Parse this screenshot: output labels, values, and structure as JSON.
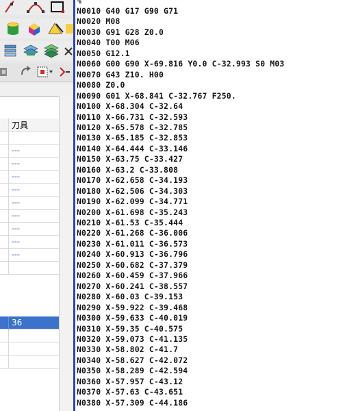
{
  "toolbar": {
    "icons": [
      "curve-tool-icon",
      "arc-tool-icon",
      "rect-tool-icon",
      "cylinder-icon",
      "box-icon",
      "stock-icon",
      "ruler-icon",
      "layers-a-icon",
      "layers-b-icon",
      "layers-c-icon",
      "misc-icon",
      "refresh-icon",
      "select-icon",
      "step-icon"
    ]
  },
  "table": {
    "header": "刀具",
    "rows": [
      "",
      "---",
      "---",
      "---",
      "---",
      "---",
      "---",
      "---",
      "---",
      "---",
      "",
      "36",
      "",
      "",
      ""
    ]
  },
  "code": {
    "first_line": "%",
    "lines": [
      "N0010 G40 G17 G90 G71",
      "N0020 M08",
      "N0030 G91 G28 Z0.0",
      "N0040 T00 M06",
      "N0050 G12.1",
      "N0060 G00 G90 X-69.816 Y0.0 C-32.993 S0 M03",
      "N0070 G43 Z10. H00",
      "N0080 Z0.0",
      "N0090 G01 X-68.841 C-32.767 F250.",
      "N0100 X-68.304 C-32.64",
      "N0110 X-66.731 C-32.593",
      "N0120 X-65.578 C-32.785",
      "N0130 X-65.185 C-32.853",
      "N0140 X-64.444 C-33.146",
      "N0150 X-63.75 C-33.427",
      "N0160 X-63.2 C-33.808",
      "N0170 X-62.658 C-34.193",
      "N0180 X-62.506 C-34.303",
      "N0190 X-62.099 C-34.771",
      "N0200 X-61.698 C-35.243",
      "N0210 X-61.53 C-35.444",
      "N0220 X-61.268 C-36.006",
      "N0230 X-61.011 C-36.573",
      "N0240 X-60.913 C-36.796",
      "N0250 X-60.682 C-37.379",
      "N0260 X-60.459 C-37.966",
      "N0270 X-60.241 C-38.557",
      "N0280 X-60.03 C-39.153",
      "N0290 X-59.922 C-39.468",
      "N0300 X-59.633 C-40.019",
      "N0310 X-59.35 C-40.575",
      "N0320 X-59.073 C-41.135",
      "N0330 X-58.802 C-41.7",
      "N0340 X-58.627 C-42.072",
      "N0350 X-58.289 C-42.594",
      "N0360 X-57.957 C-43.12",
      "N0370 X-57.63 C-43.651",
      "N0380 X-57.309 C-44.186"
    ]
  }
}
